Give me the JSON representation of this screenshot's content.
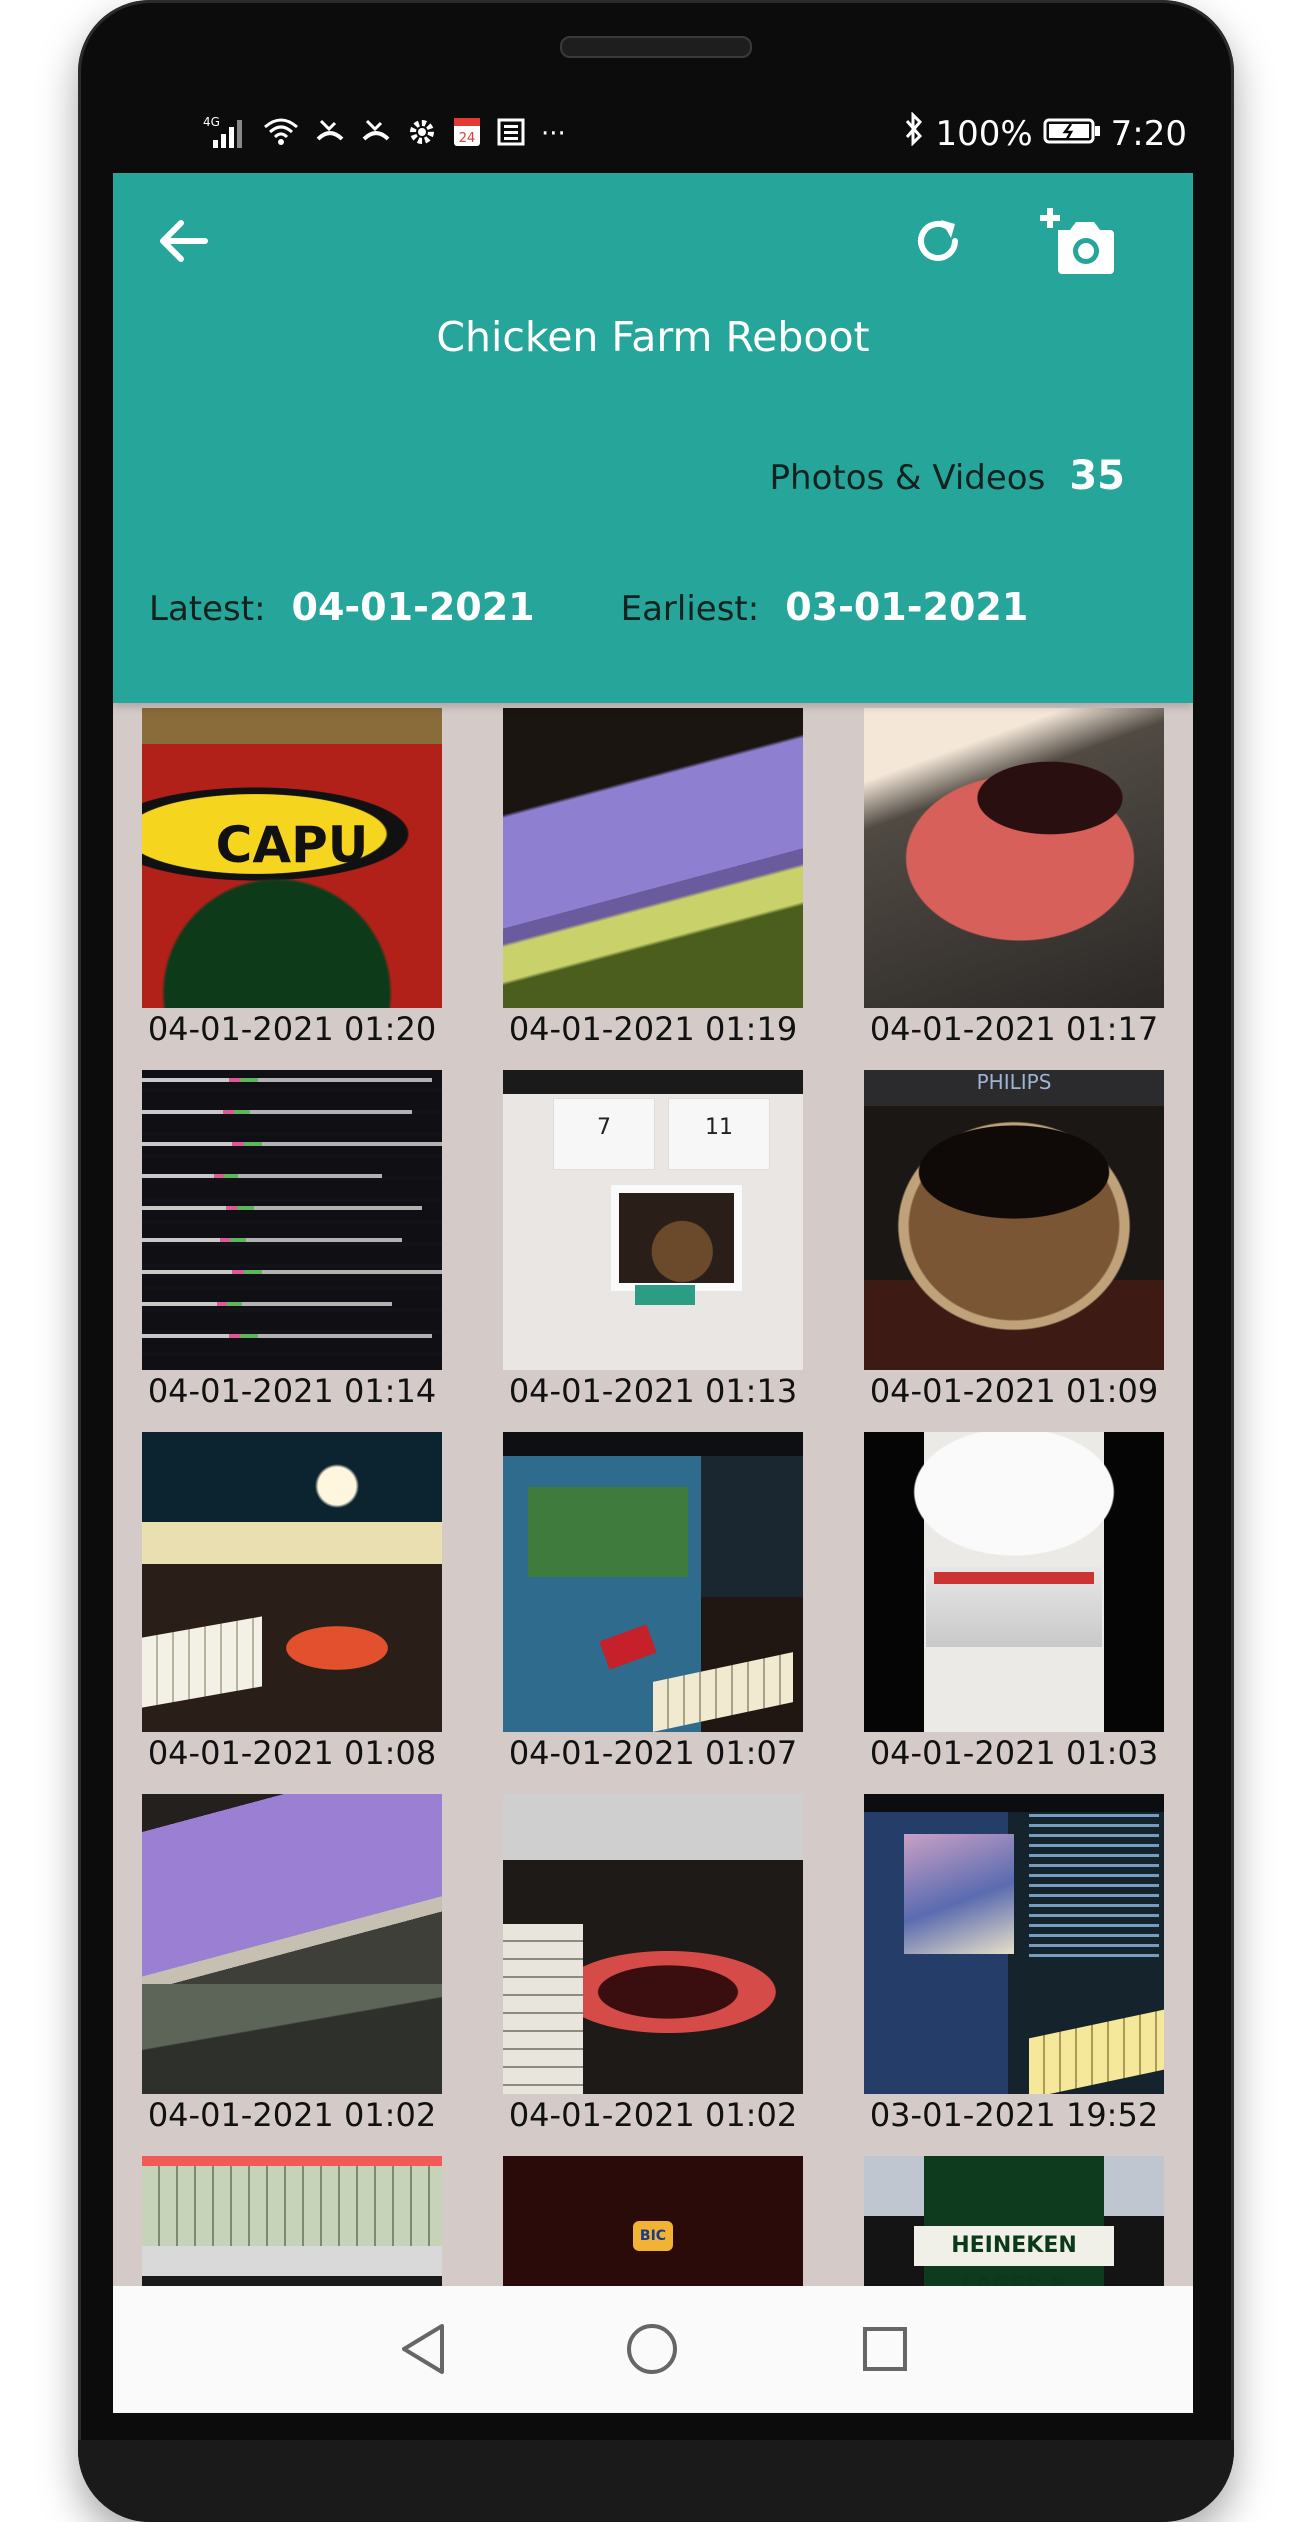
{
  "status_bar": {
    "network": "4G",
    "calendar_day": "24",
    "more": "···",
    "battery": "100%",
    "time": "7:20"
  },
  "header": {
    "title": "Chicken Farm Reboot",
    "count_label": "Photos & Videos",
    "count_value": "35",
    "latest_label": "Latest:",
    "latest_value": "04-01-2021",
    "earliest_label": "Earliest:",
    "earliest_value": "03-01-2021",
    "background_color": "#26a69a"
  },
  "gallery": {
    "items": [
      {
        "caption": "04-01-2021 01:20",
        "image_text": "CAPU"
      },
      {
        "caption": "04-01-2021 01:19"
      },
      {
        "caption": "04-01-2021 01:17"
      },
      {
        "caption": "04-01-2021 01:14"
      },
      {
        "caption": "04-01-2021 01:13",
        "image_text_left": "7",
        "image_text_right": "11"
      },
      {
        "caption": "04-01-2021 01:09",
        "image_text": "PHILIPS"
      },
      {
        "caption": "04-01-2021 01:08"
      },
      {
        "caption": "04-01-2021 01:07"
      },
      {
        "caption": "04-01-2021 01:03"
      },
      {
        "caption": "04-01-2021 01:02"
      },
      {
        "caption": "04-01-2021 01:02"
      },
      {
        "caption": "03-01-2021 19:52"
      },
      {
        "caption": ""
      },
      {
        "caption": "",
        "image_text": "BIC"
      },
      {
        "caption": "",
        "image_text": "HEINEKEN LAGER B"
      }
    ]
  },
  "icons": {
    "back": "arrow-left-icon",
    "refresh": "refresh-icon",
    "add_photo": "add-a-photo-icon",
    "nav_back": "triangle-back-icon",
    "nav_home": "circle-home-icon",
    "nav_recents": "square-recents-icon"
  }
}
